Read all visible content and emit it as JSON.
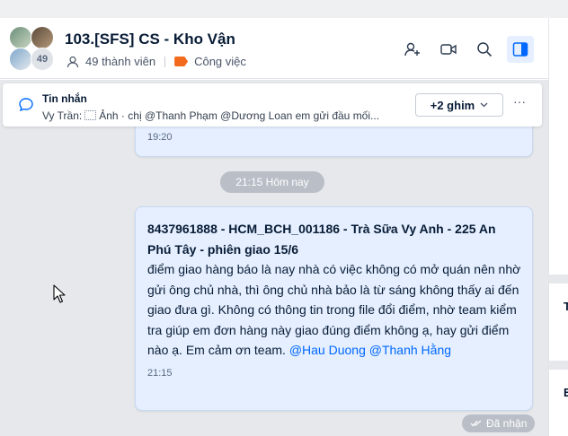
{
  "header": {
    "title": "103.[SFS] CS - Kho Vận",
    "avatar_count": "49",
    "members": "49 thành viên",
    "tag": "Công việc",
    "tag_color": "#f26a1b",
    "icons": [
      "add-member-icon",
      "video-call-icon",
      "search-icon",
      "sidebar-toggle-icon"
    ]
  },
  "pinned": {
    "title": "Tin nhắn",
    "sender": "Vy Trần:",
    "preview": "Ảnh · chị @Thanh Phạm @Dương Loan em gửi đầu mối...",
    "pins_button": "+2 ghim",
    "more": "···"
  },
  "messages": {
    "previous_time": "19:20",
    "date_separator": "21:15 Hôm nay",
    "main": {
      "headline": "8437961888 - HCM_BCH_001186 - Trà Sữa Vy Anh - 225 An Phú Tây - phiên giao 15/6",
      "body": "điểm giao hàng báo là nay nhà có việc không có mở quán nên nhờ gửi ông chủ nhà, thì ông chủ nhà bảo là từ sáng không thấy ai đến giao đưa gì. Không có thông tin trong file đổi điểm, nhờ team kiểm tra giúp em đơn hàng này giao đúng điểm không ạ, hay gửi điểm nào ạ. Em cảm ơn team.",
      "mention_1": "@Hau Duong",
      "mention_2": "@Thanh Hằng",
      "time": "21:15"
    },
    "status": "Đã nhận"
  },
  "right_panel": {
    "letter_1": "T",
    "letter_2": "E"
  },
  "colors": {
    "accent": "#0068ff",
    "bubble": "#e5efff",
    "chat_bg": "#e6e8eb"
  }
}
